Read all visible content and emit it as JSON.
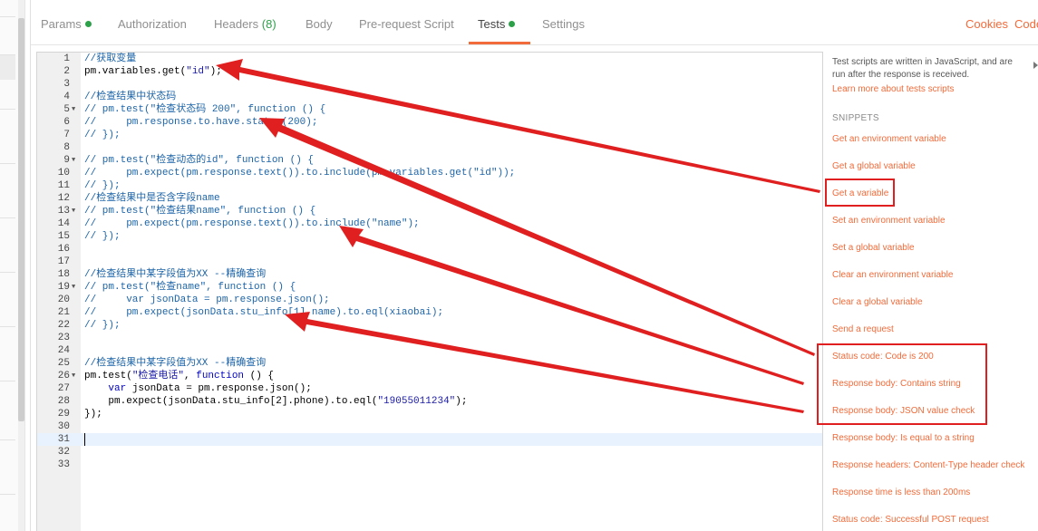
{
  "tabs": [
    {
      "label": "Params",
      "dot": true,
      "count": ""
    },
    {
      "label": "Authorization",
      "dot": false,
      "count": ""
    },
    {
      "label": "Headers",
      "dot": false,
      "count": "(8)"
    },
    {
      "label": "Body",
      "dot": false,
      "count": ""
    },
    {
      "label": "Pre-request Script",
      "dot": false,
      "count": ""
    },
    {
      "label": "Tests",
      "dot": true,
      "count": "",
      "active": true
    },
    {
      "label": "Settings",
      "dot": false,
      "count": ""
    }
  ],
  "links": {
    "cookies": "Cookies",
    "code": "Code"
  },
  "editor": {
    "lines": [
      {
        "n": "1",
        "fold": false,
        "html": "<span class='cm'>//获取变量</span>"
      },
      {
        "n": "2",
        "fold": false,
        "html": "pm.variables.get(<span class='str'>\"id\"</span>);"
      },
      {
        "n": "3",
        "fold": false,
        "html": ""
      },
      {
        "n": "4",
        "fold": false,
        "html": "<span class='cm'>//检查结果中状态码</span>"
      },
      {
        "n": "5",
        "fold": true,
        "html": "<span class='cm'>// pm.test(\"检查状态码 200\", function () {</span>"
      },
      {
        "n": "6",
        "fold": false,
        "html": "<span class='cm'>//     pm.response.to.have.status(200);</span>"
      },
      {
        "n": "7",
        "fold": false,
        "html": "<span class='cm'>// });</span>"
      },
      {
        "n": "8",
        "fold": false,
        "html": ""
      },
      {
        "n": "9",
        "fold": true,
        "html": "<span class='cm'>// pm.test(\"检查动态的id\", function () {</span>"
      },
      {
        "n": "10",
        "fold": false,
        "html": "<span class='cm'>//     pm.expect(pm.response.text()).to.include(pm.variables.get(\"id\"));</span>"
      },
      {
        "n": "11",
        "fold": false,
        "html": "<span class='cm'>// });</span>"
      },
      {
        "n": "12",
        "fold": false,
        "html": "<span class='cm'>//检查结果中是否含字段name</span>"
      },
      {
        "n": "13",
        "fold": true,
        "html": "<span class='cm'>// pm.test(\"检查结果name\", function () {</span>"
      },
      {
        "n": "14",
        "fold": false,
        "html": "<span class='cm'>//     pm.expect(pm.response.text()).to.include(\"name\");</span>"
      },
      {
        "n": "15",
        "fold": false,
        "html": "<span class='cm'>// });</span>"
      },
      {
        "n": "16",
        "fold": false,
        "html": ""
      },
      {
        "n": "17",
        "fold": false,
        "html": ""
      },
      {
        "n": "18",
        "fold": false,
        "html": "<span class='cm'>//检查结果中某字段值为XX --精确查询</span>"
      },
      {
        "n": "19",
        "fold": true,
        "html": "<span class='cm'>// pm.test(\"检查name\", function () {</span>"
      },
      {
        "n": "20",
        "fold": false,
        "html": "<span class='cm'>//     var jsonData = pm.response.json();</span>"
      },
      {
        "n": "21",
        "fold": false,
        "html": "<span class='cm'>//     pm.expect(jsonData.stu_info[1].name).to.eql(xiaobai);</span>"
      },
      {
        "n": "22",
        "fold": false,
        "html": "<span class='cm'>// });</span>"
      },
      {
        "n": "23",
        "fold": false,
        "html": ""
      },
      {
        "n": "24",
        "fold": false,
        "html": ""
      },
      {
        "n": "25",
        "fold": false,
        "html": "<span class='cm'>//检查结果中某字段值为XX --精确查询</span>"
      },
      {
        "n": "26",
        "fold": true,
        "html": "pm.test(<span class='str'>\"检查电话\"</span>, <span class='kw'>function</span> () {"
      },
      {
        "n": "27",
        "fold": false,
        "html": "    <span class='kw'>var</span> jsonData = pm.response.json();"
      },
      {
        "n": "28",
        "fold": false,
        "html": "    pm.expect(jsonData.stu_info[2].phone).to.eql(<span class='str'>\"19055011234\"</span>);"
      },
      {
        "n": "29",
        "fold": false,
        "html": "});"
      },
      {
        "n": "30",
        "fold": false,
        "html": ""
      },
      {
        "n": "31",
        "fold": false,
        "html": "",
        "active": true
      },
      {
        "n": "32",
        "fold": false,
        "html": ""
      },
      {
        "n": "33",
        "fold": false,
        "html": ""
      }
    ]
  },
  "side": {
    "description": "Test scripts are written in JavaScript, and are run after the response is received.",
    "learn_more": "Learn more about tests scripts",
    "snippets_heading": "SNIPPETS",
    "snippets": [
      "Get an environment variable",
      "Get a global variable",
      "Get a variable",
      "Set an environment variable",
      "Set a global variable",
      "Clear an environment variable",
      "Clear a global variable",
      "Send a request",
      "Status code: Code is 200",
      "Response body: Contains string",
      "Response body: JSON value check",
      "Response body: Is equal to a string",
      "Response headers: Content-Type header check",
      "Response time is less than 200ms",
      "Status code: Successful POST request"
    ]
  },
  "colors": {
    "accent": "#f26b3a",
    "green_dot": "#2da14a",
    "annotation": "#e02020"
  }
}
